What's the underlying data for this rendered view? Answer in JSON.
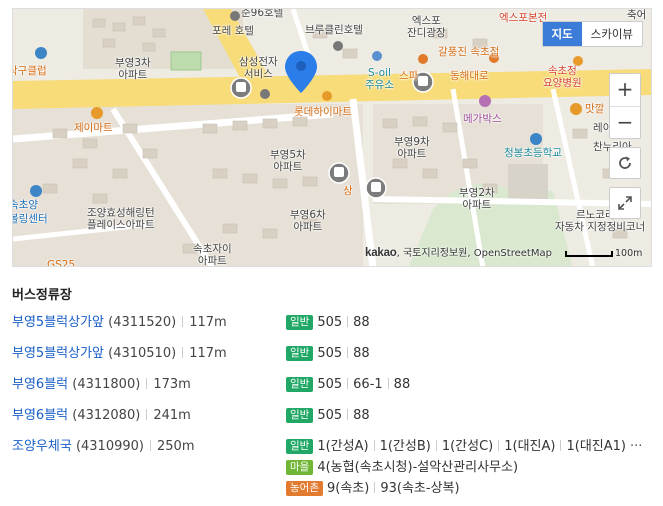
{
  "map": {
    "type_buttons": [
      "지도",
      "스카이뷰"
    ],
    "active_type": "지도",
    "zoom_in": "+",
    "zoom_out": "−",
    "attribution_brand": "kakao",
    "attribution_text": ", 국토지리정보원, OpenStreetMap",
    "scale_label": "100m",
    "labels": {
      "sun96": "순96호텔",
      "porae": "포레 호텔",
      "brooklyn": "브루클린호텔",
      "expo_jangi": "엑스포\n잔디광장",
      "expo_tower": "엑스포본전",
      "chuk": "축어",
      "gal": "갈",
      "ttak": "탁구클럽",
      "buyeong3": "부영3차\n아파트",
      "samsung": "삼성전자\n서비스",
      "soil": "S-oil\n주유소",
      "gapung": "갈풍진 속초점",
      "donghae": "동해대로",
      "spa": "스파",
      "sokcho_hosp": "속초정\n요양병원",
      "lotte": "롯데하이마트",
      "jeimart": "제이마트",
      "megabox": "메가박스",
      "matgal": "맛깔",
      "buyeong9": "부영9차\n아파트",
      "rei": "레이",
      "cheongbong": "청봉초등학교",
      "chaenu": "찬누리아",
      "buyeong5": "부영5차\n아파트",
      "sokcho_yang": "속초양",
      "bowling": "볼링센터",
      "buyeong2": "부영2차\n아파트",
      "joyang": "조양효성해링턴\n플레이스아파트",
      "buyeong6": "부영6차\n아파트",
      "renault": "르노코리아\n자동차 지정정비코너",
      "sokchojai": "속초자이\n아파트",
      "gs25": "GS25",
      "sang": "상"
    }
  },
  "section_title": "버스정류장",
  "stops": [
    {
      "name": "부영5블럭상가앞",
      "id": "(4311520)",
      "distance": "117m",
      "route_groups": [
        {
          "type": "일반",
          "routes": [
            "505",
            "88"
          ]
        }
      ]
    },
    {
      "name": "부영5블럭상가앞",
      "id": "(4310510)",
      "distance": "117m",
      "route_groups": [
        {
          "type": "일반",
          "routes": [
            "505",
            "88"
          ]
        }
      ]
    },
    {
      "name": "부영6블럭",
      "id": "(4311800)",
      "distance": "173m",
      "route_groups": [
        {
          "type": "일반",
          "routes": [
            "505",
            "66-1",
            "88"
          ]
        }
      ]
    },
    {
      "name": "부영6블럭",
      "id": "(4312080)",
      "distance": "241m",
      "route_groups": [
        {
          "type": "일반",
          "routes": [
            "505",
            "88"
          ]
        }
      ]
    },
    {
      "name": "조양우체국",
      "id": "(4310990)",
      "distance": "250m",
      "route_groups": [
        {
          "type": "일반",
          "routes": [
            "1(간성A)",
            "1(간성B)",
            "1(간성C)",
            "1(대진A)",
            "1(대진A1)"
          ],
          "more": "···"
        },
        {
          "type": "마을",
          "routes": [
            "4(농협(속초시청)-설악산관리사무소)"
          ]
        },
        {
          "type": "농어촌",
          "routes": [
            "9(속초)",
            "93(속초-상복)"
          ]
        }
      ]
    }
  ]
}
